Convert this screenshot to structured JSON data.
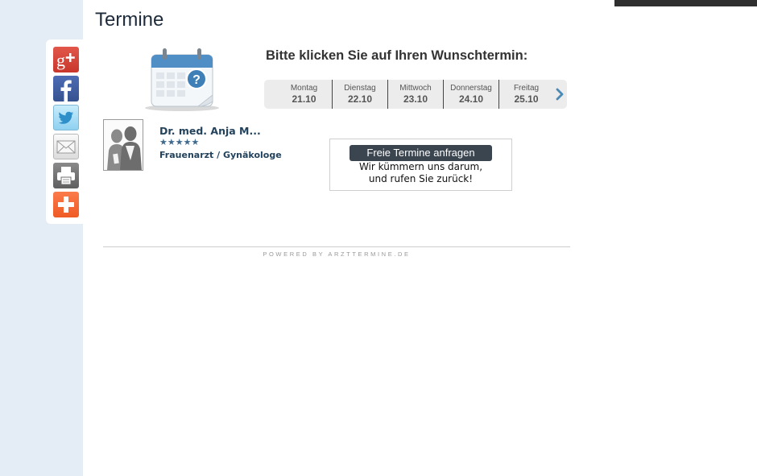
{
  "page": {
    "title": "Termine"
  },
  "share_bar": {
    "buttons": [
      {
        "name": "google-plus",
        "icon": "google-plus-icon",
        "color": "#d6493b"
      },
      {
        "name": "facebook",
        "icon": "facebook-icon",
        "color": "#3b5998"
      },
      {
        "name": "twitter",
        "icon": "twitter-bird-icon",
        "color": "#8fd1f1"
      },
      {
        "name": "email",
        "icon": "envelope-icon",
        "color": "#e6e6e6"
      },
      {
        "name": "print",
        "icon": "printer-icon",
        "color": "#6d6d6d"
      },
      {
        "name": "more",
        "icon": "plus-icon",
        "color": "#f26a33"
      }
    ]
  },
  "appointments": {
    "prompt": "Bitte klicken Sie auf Ihren Wunschtermin:",
    "calendar_icon": "calendar-question-icon",
    "days": [
      {
        "name": "Montag",
        "date": "21.10"
      },
      {
        "name": "Dienstag",
        "date": "22.10"
      },
      {
        "name": "Mittwoch",
        "date": "23.10"
      },
      {
        "name": "Donnerstag",
        "date": "24.10"
      },
      {
        "name": "Freitag",
        "date": "25.10"
      }
    ],
    "next_icon": "chevron-right-icon"
  },
  "doctor": {
    "name": "Dr. med. Anja M...",
    "rating": 5,
    "rating_max": 5,
    "specialty": "Frauenarzt / Gynäkologe",
    "avatar_icon": "doctor-silhouette-icon"
  },
  "request": {
    "button_label": "Freie Termine anfragen",
    "line1": "Wir kümmern uns darum,",
    "line2": "und rufen Sie zurück!"
  },
  "footer": {
    "powered_by": "POWERED BY ARZTTERMINE.DE"
  },
  "colors": {
    "left_strip": "#e4ecf5",
    "accent_text": "#23425c",
    "request_button": "#3a4550"
  }
}
